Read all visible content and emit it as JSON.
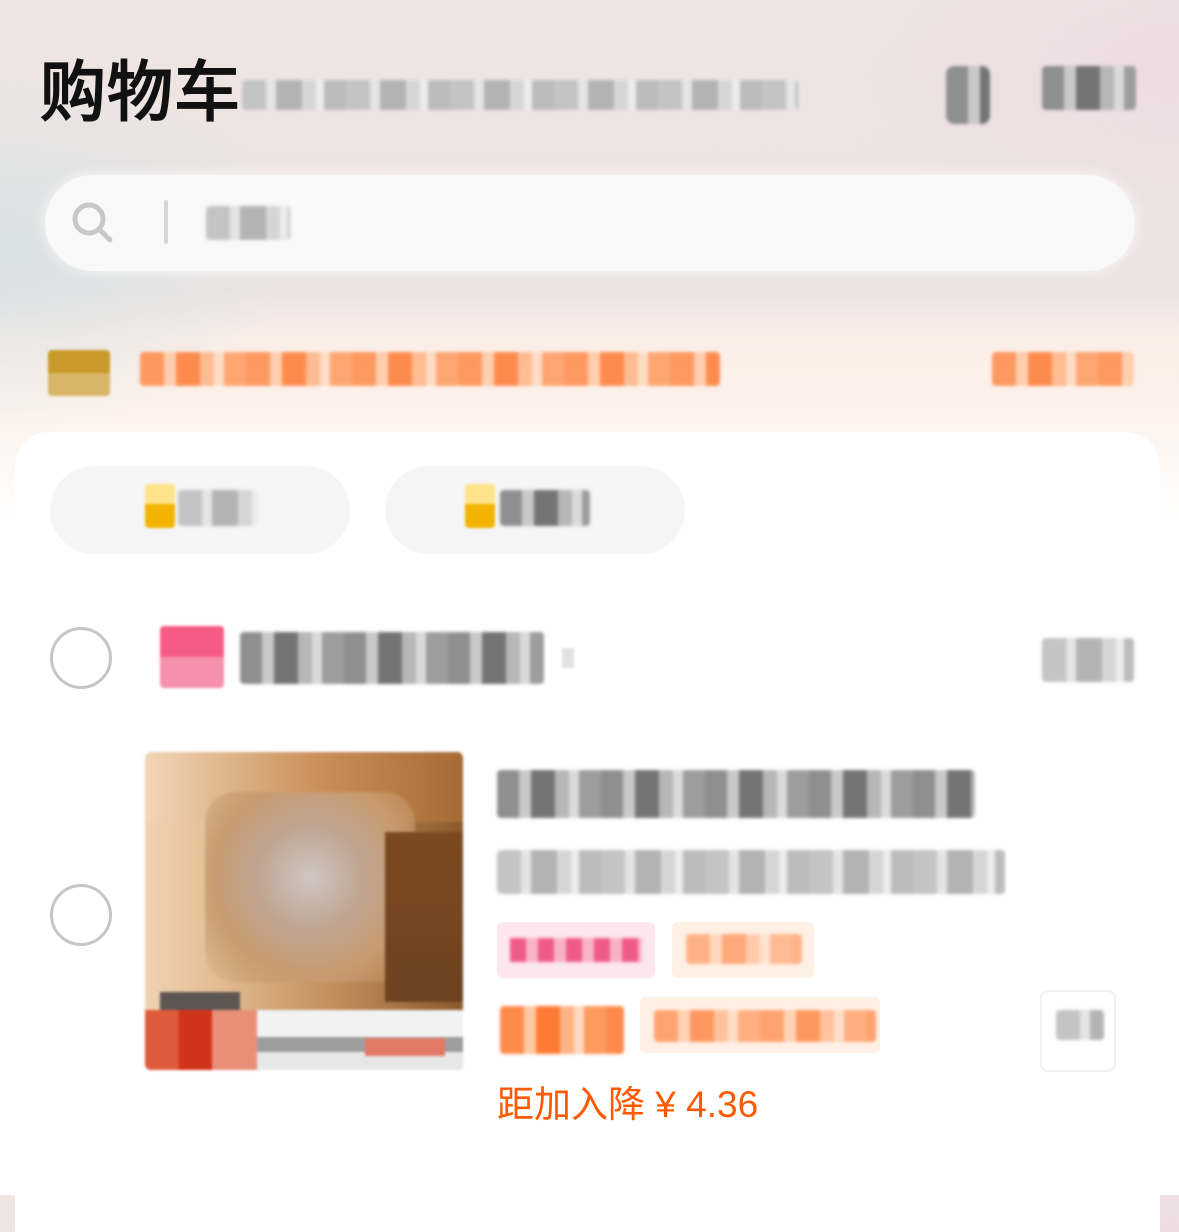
{
  "header": {
    "title": "购物车",
    "icons": [
      "manage-icon",
      "more-icon"
    ]
  },
  "search": {
    "icon": "search-icon"
  },
  "cart_item": {
    "price_drop_note": "距加入降 ¥ 4.36"
  },
  "colors": {
    "accent_orange": "#ff5a00",
    "title_text": "#111111",
    "checkbox_border": "#c6c6c6",
    "card_background": "#ffffff"
  }
}
